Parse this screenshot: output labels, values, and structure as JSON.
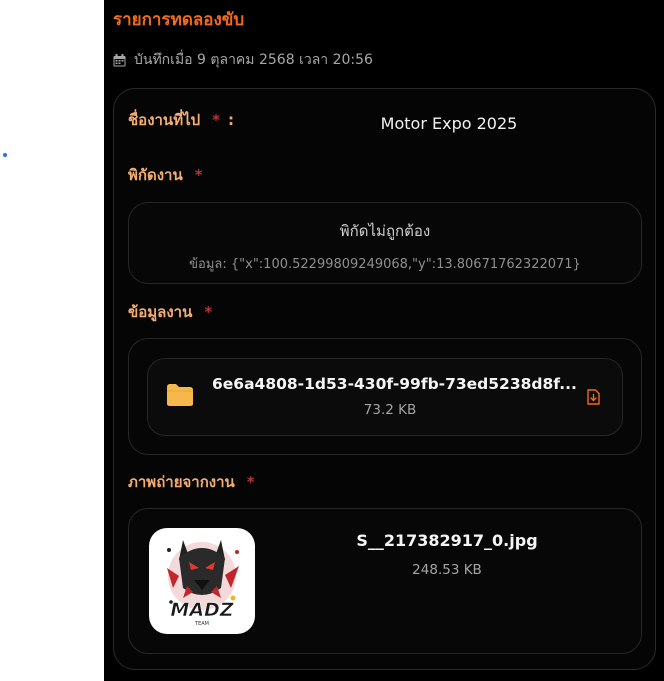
{
  "page": {
    "title": "รายการทดลองขับ",
    "saved_text": "บันทึกเมื่อ 9 ตุลาคม 2568 เวลา 20:56"
  },
  "fields": {
    "event_name_label": "ชื่องานที่ไป",
    "event_name_required": "*",
    "event_name_colon": ":",
    "event_name_value": "Motor Expo 2025",
    "location_label": "พิกัดงาน",
    "location_required": "*",
    "location_error": "พิกัดไม่ถูกต้อง",
    "location_data": "ข้อมูล: {\"x\":100.52299809249068,\"y\":13.80671762322071}",
    "event_info_label": "ข้อมูลงาน",
    "event_info_required": "*",
    "photo_label": "ภาพถ่ายจากงาน",
    "photo_required": "*"
  },
  "file": {
    "name": "6e6a4808-1d53-430f-99fb-73ed5238d8f...",
    "size": "73.2 KB",
    "icon": "folder-icon"
  },
  "photo": {
    "name": "S__217382917_0.jpg",
    "size": "248.53 KB",
    "logo_text": "MADZ",
    "logo_subtext": "TEAM"
  },
  "colors": {
    "accent": "#f26a1b",
    "label": "#f3ad72",
    "required": "#a83a3a",
    "folder": "#f7b84b"
  }
}
